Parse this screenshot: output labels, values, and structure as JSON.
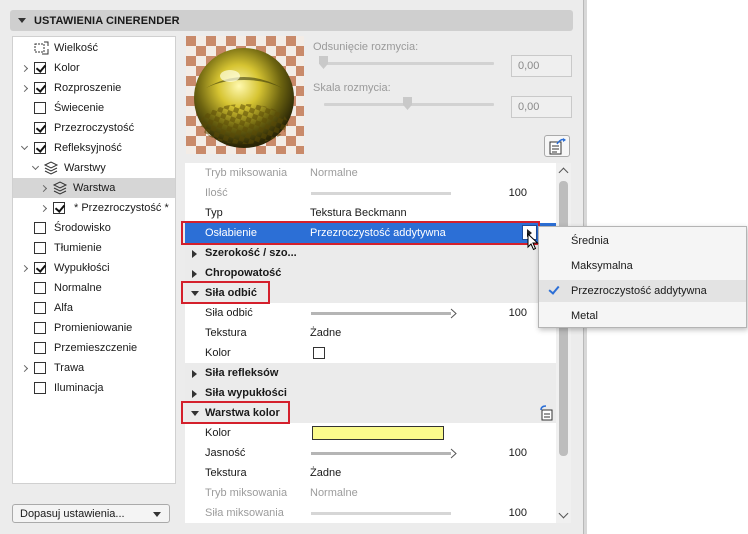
{
  "header": {
    "title": "USTAWIENIA CINERENDER"
  },
  "tree": {
    "items": [
      {
        "label": "Wielkość",
        "icon": "size-icon"
      },
      {
        "label": "Kolor",
        "checked": true
      },
      {
        "label": "Rozproszenie",
        "checked": true
      },
      {
        "label": "Świecenie",
        "checked": false
      },
      {
        "label": "Przezroczystość",
        "checked": true
      },
      {
        "label": "Refleksyjność",
        "checked": true
      },
      {
        "label": "Warstwy",
        "icon": "layers-icon"
      },
      {
        "label": "Warstwa",
        "icon": "layer-icon",
        "selected": true
      },
      {
        "label": "* Przezroczystość *",
        "checked": true
      },
      {
        "label": "Środowisko",
        "checked": false
      },
      {
        "label": "Tłumienie",
        "checked": false
      },
      {
        "label": "Wypukłości",
        "checked": true
      },
      {
        "label": "Normalne",
        "checked": false
      },
      {
        "label": "Alfa",
        "checked": false
      },
      {
        "label": "Promieniowanie",
        "checked": false
      },
      {
        "label": "Przemieszczenie",
        "checked": false
      },
      {
        "label": "Trawa",
        "checked": false
      },
      {
        "label": "Iluminacja",
        "checked": false
      }
    ],
    "fit_button": "Dopasuj ustawienia..."
  },
  "preview": {
    "blur_offset_label": "Odsunięcie rozmycia:",
    "blur_offset_value": "0,00",
    "blur_scale_label": "Skala rozmycia:",
    "blur_scale_value": "0,00"
  },
  "props": {
    "mix_mode": {
      "key": "Tryb miksowania",
      "value": "Normalne"
    },
    "amount": {
      "key": "Ilość",
      "value": "100"
    },
    "type": {
      "key": "Typ",
      "value": "Tekstura Beckmann"
    },
    "attenuation": {
      "key": "Osłabienie",
      "value": "Przezroczystość addytywna"
    },
    "width_group": "Szerokość / szo...",
    "roughness_group": "Chropowatość",
    "reflect_strength_group": "Siła odbić",
    "reflect_strength": {
      "key": "Siła odbić",
      "value": "100"
    },
    "texture1": {
      "key": "Tekstura",
      "value": "Żadne"
    },
    "color1": {
      "key": "Kolor"
    },
    "highlight_group": "Siła refleksów",
    "bump_group": "Siła wypukłości",
    "color_layer_group": "Warstwa kolor",
    "color2": {
      "key": "Kolor",
      "swatch": "#fafa8c"
    },
    "brightness": {
      "key": "Jasność",
      "value": "100"
    },
    "texture2": {
      "key": "Tekstura",
      "value": "Żadne"
    },
    "mix_mode2": {
      "key": "Tryb miksowania",
      "value": "Normalne"
    },
    "mix_strength": {
      "key": "Siła miksowania",
      "value": "100"
    }
  },
  "popup": {
    "items": [
      "Średnia",
      "Maksymalna",
      "Przezroczystość addytywna",
      "Metal"
    ],
    "selected": "Przezroczystość addytywna"
  },
  "colors": {
    "selection": "#2c6fd6",
    "highlight_box": "#d4202c"
  }
}
